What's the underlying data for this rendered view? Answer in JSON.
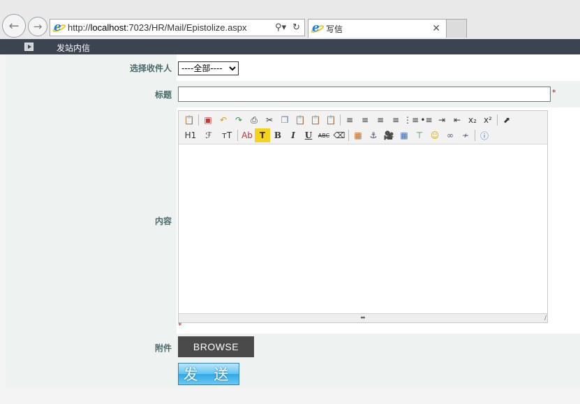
{
  "browser": {
    "url_prefix": "http://",
    "url_host": "localhost",
    "url_rest": ":7023/HR/Mail/Epistolize.aspx",
    "tab_title": "写信",
    "back_icon": "back-arrow-icon",
    "forward_icon": "forward-arrow-icon",
    "search_icon": "search-icon",
    "refresh_icon": "refresh-icon",
    "close_icon": "close-icon"
  },
  "header": {
    "title": "发站内信"
  },
  "form": {
    "recipient_label": "选择收件人",
    "recipient_selected": "----全部----",
    "subject_label": "标题",
    "subject_value": "",
    "content_label": "内容",
    "attachment_label": "附件",
    "required_mark": "*",
    "browse_label": "BROWSE",
    "send_label": "发 送"
  },
  "editor": {
    "toolbar_row1": [
      "source",
      "fullscreen",
      "undo",
      "redo",
      "print",
      "cut",
      "copy",
      "paste",
      "paste-text",
      "paste-word",
      "align-left",
      "align-center",
      "align-right",
      "justify",
      "ordered-list",
      "unordered-list",
      "indent",
      "outdent",
      "subscript",
      "superscript",
      "select"
    ],
    "toolbar_row2": [
      "heading",
      "font-family",
      "font-size",
      "font-color",
      "highlight",
      "bold",
      "italic",
      "underline",
      "strikethrough",
      "eraser",
      "image",
      "flash",
      "media",
      "table",
      "hr",
      "emoticon",
      "link",
      "unlink",
      "help"
    ],
    "heading_text": "H1",
    "fontfamily_text": "ℱ",
    "fontsize_text": "тT",
    "fontcolor_text": "Ab",
    "highlight_text": "T",
    "bold_text": "B",
    "italic_text": "I",
    "underline_text": "U",
    "strike_text": "ABC",
    "sub_text": "x₂",
    "sup_text": "x²"
  }
}
